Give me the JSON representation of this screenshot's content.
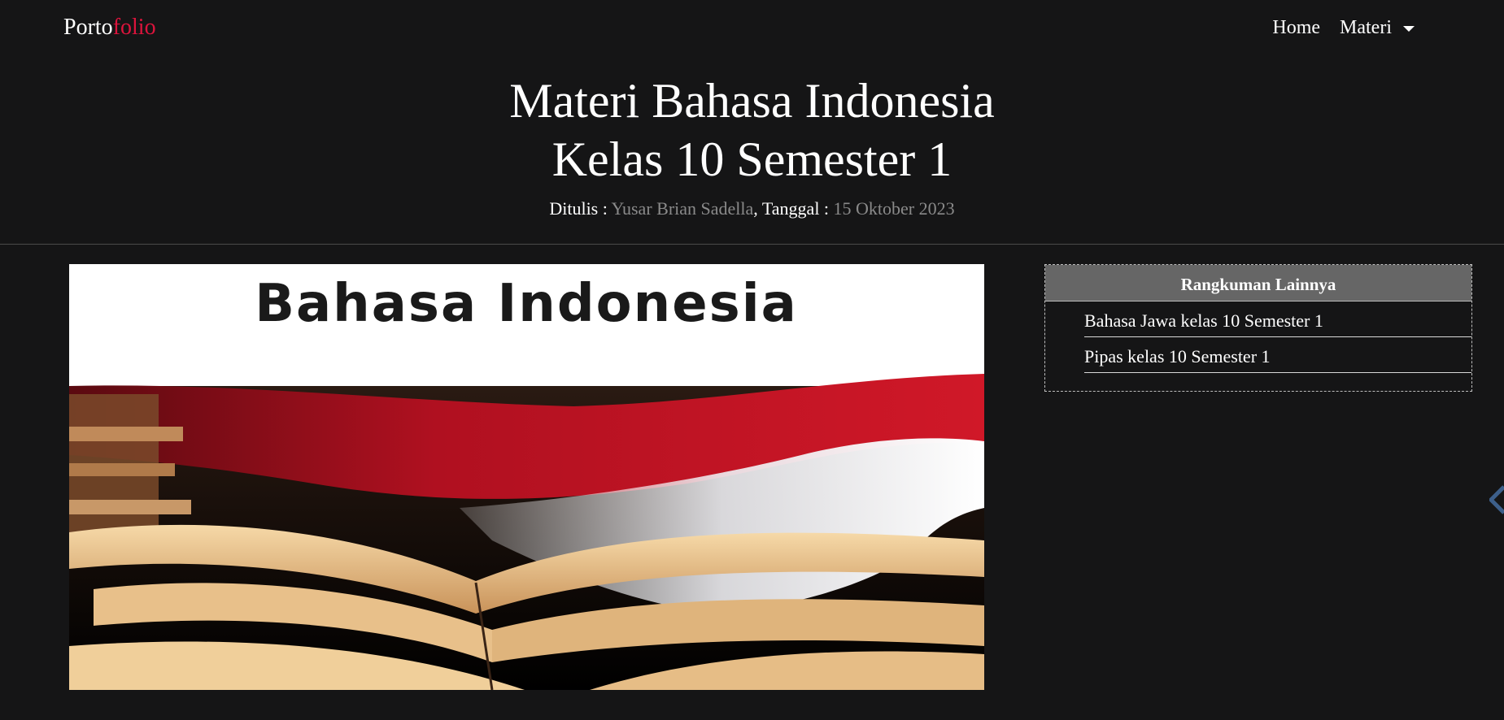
{
  "navbar": {
    "brand_part1": "Porto",
    "brand_part2": "folio",
    "links": [
      {
        "label": "Home"
      },
      {
        "label": "Materi"
      }
    ]
  },
  "hero": {
    "title_line1": "Materi Bahasa Indonesia",
    "title_line2": "Kelas 10 Semester 1",
    "meta": {
      "written_label": "Ditulis :",
      "author": "Yusar Brian Sadella",
      "separator": ",",
      "date_label": "Tanggal :",
      "date": "15 Oktober 2023"
    }
  },
  "image": {
    "text": "Bahasa Indonesia"
  },
  "sidebar": {
    "header": "Rangkuman Lainnya",
    "items": [
      {
        "label": "Bahasa Jawa kelas 10 Semester 1"
      },
      {
        "label": "Pipas kelas 10 Semester 1"
      }
    ]
  },
  "colors": {
    "background": "#151516",
    "accent": "#dc143c",
    "muted": "#8a8a8a",
    "sidebar_header": "#666666"
  }
}
